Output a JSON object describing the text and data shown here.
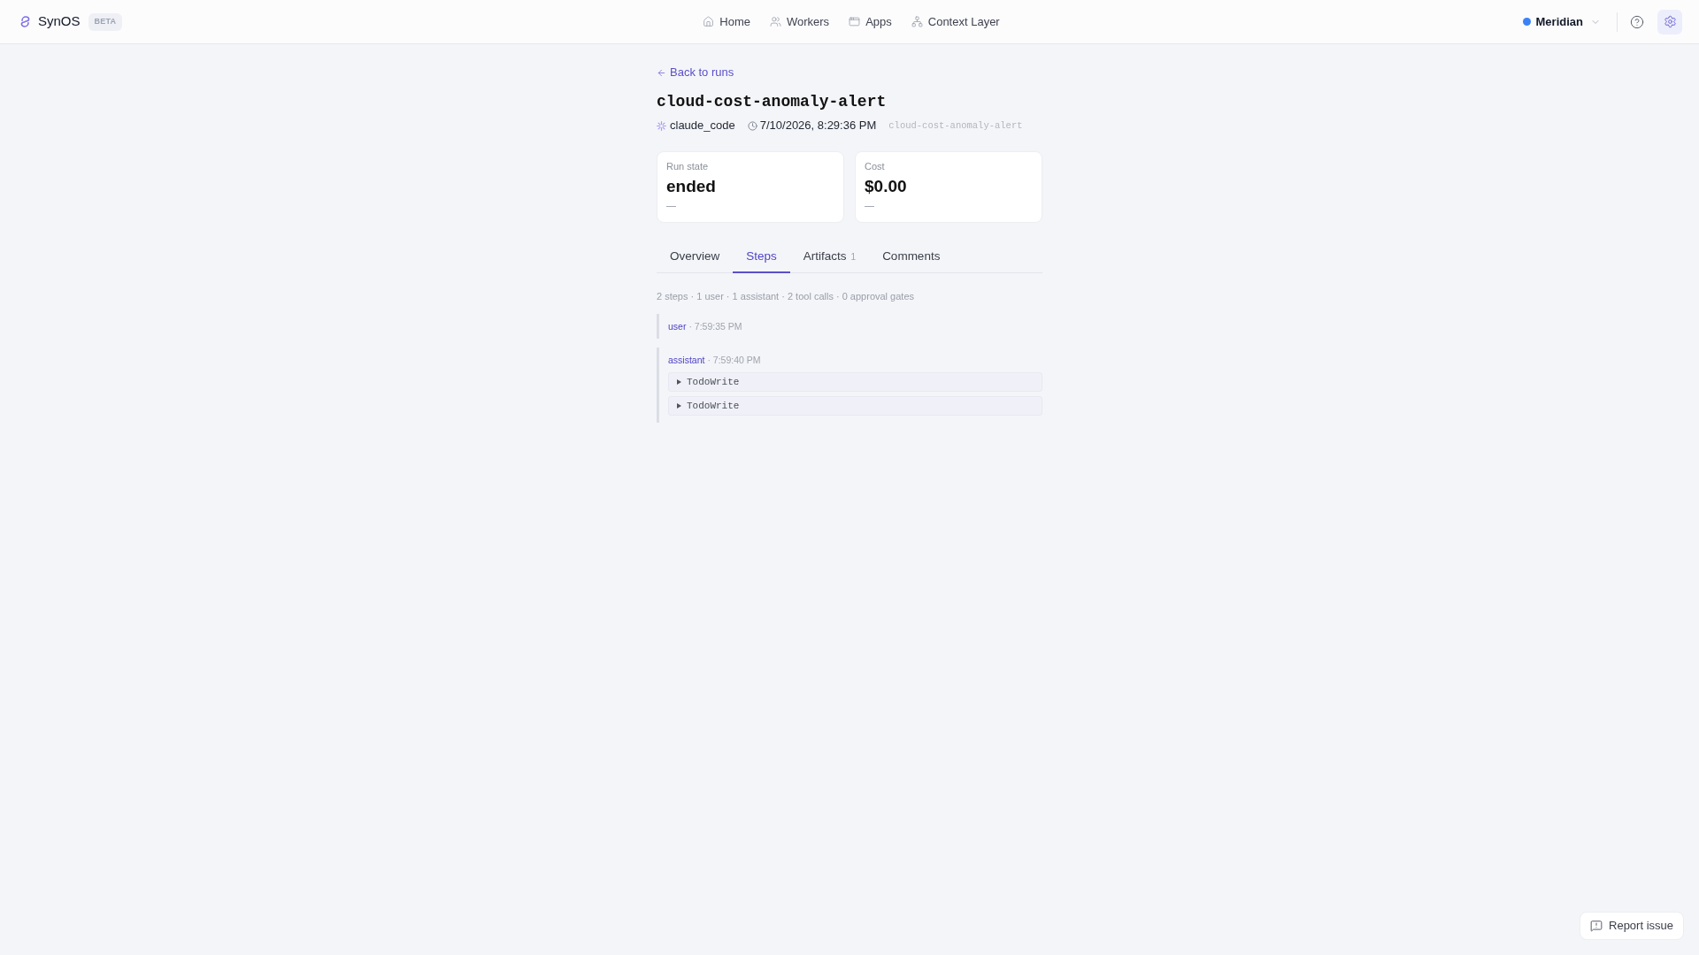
{
  "header": {
    "brand": "SynOS",
    "badge": "BETA",
    "nav": [
      {
        "label": "Home",
        "selected": false
      },
      {
        "label": "Workers",
        "selected": false
      },
      {
        "label": "Apps",
        "selected": false
      },
      {
        "label": "Context Layer",
        "selected": false
      }
    ],
    "workspace": "Meridian"
  },
  "back_link": "Back to runs",
  "run": {
    "title": "cloud-cost-anomaly-alert",
    "agent": "claude_code",
    "started": "7/10/2026, 8:29:36 PM",
    "slug": "cloud-cost-anomaly-alert"
  },
  "stats": [
    {
      "label": "Run state",
      "value": "ended",
      "note": "—"
    },
    {
      "label": "Cost",
      "value": "$0.00",
      "note": "—"
    }
  ],
  "tabs": [
    {
      "label": "Overview",
      "selected": false
    },
    {
      "label": "Steps",
      "selected": true
    },
    {
      "label": "Artifacts",
      "count": "1",
      "selected": false
    },
    {
      "label": "Comments",
      "selected": false
    }
  ],
  "summary": "2 steps · 1 user · 1 assistant · 2 tool calls · 0 approval gates",
  "steps": [
    {
      "role": "user",
      "time": "· 7:59:35 PM"
    },
    {
      "role": "assistant",
      "time": "· 7:59:40 PM",
      "tool_calls": [
        {
          "name": "TodoWrite",
          "expanded": false
        },
        {
          "name": "TodoWrite",
          "expanded": false
        }
      ]
    }
  ],
  "report_button": "Report issue"
}
